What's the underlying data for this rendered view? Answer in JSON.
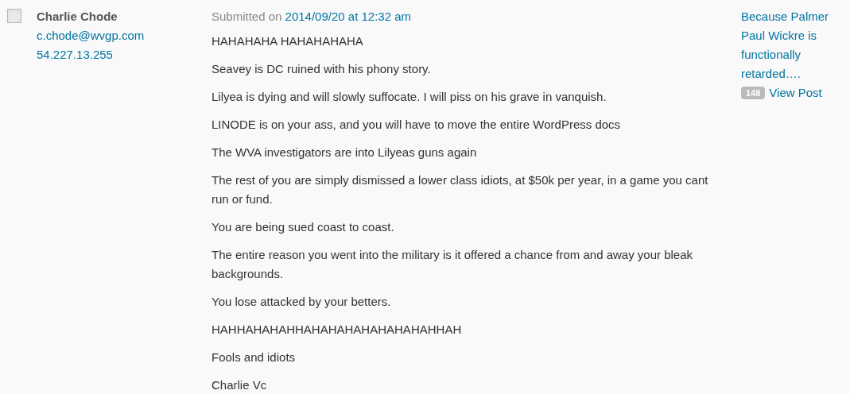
{
  "comment": {
    "checked": false,
    "author": {
      "name": "Charlie Chode",
      "email": "c.chode@wvgp.com",
      "ip": "54.227.13.255"
    },
    "submitted": {
      "prefix": "Submitted on",
      "date": "2014/09/20 at 12:32 am"
    },
    "paragraphs": [
      "HAHAHAHA HAHAHAHAHA",
      "Seavey is DC ruined with his phony story.",
      "Lilyea is dying and will slowly suffocate. I will piss on his grave in vanquish.",
      "LINODE is on your ass, and you will have to move the entire WordPress docs",
      "The WVA investigators are into Lilyeas guns again",
      "The rest of you are simply dismissed a lower class idiots, at $50k per year, in a game you cant run or fund.",
      "You are being sued coast to coast.",
      "The entire reason you went into the military is it offered a chance from and away your bleak backgrounds.",
      "You lose attacked by your betters.",
      "HAHHAHAHAHHAHAHAHAHAHAHAHAHHAH",
      "Fools and idiots",
      "Charlie Vc"
    ],
    "response": {
      "post_title": "Because Palmer Paul Wickre is functionally retarded….",
      "count": "148",
      "view_post": "View Post"
    }
  }
}
